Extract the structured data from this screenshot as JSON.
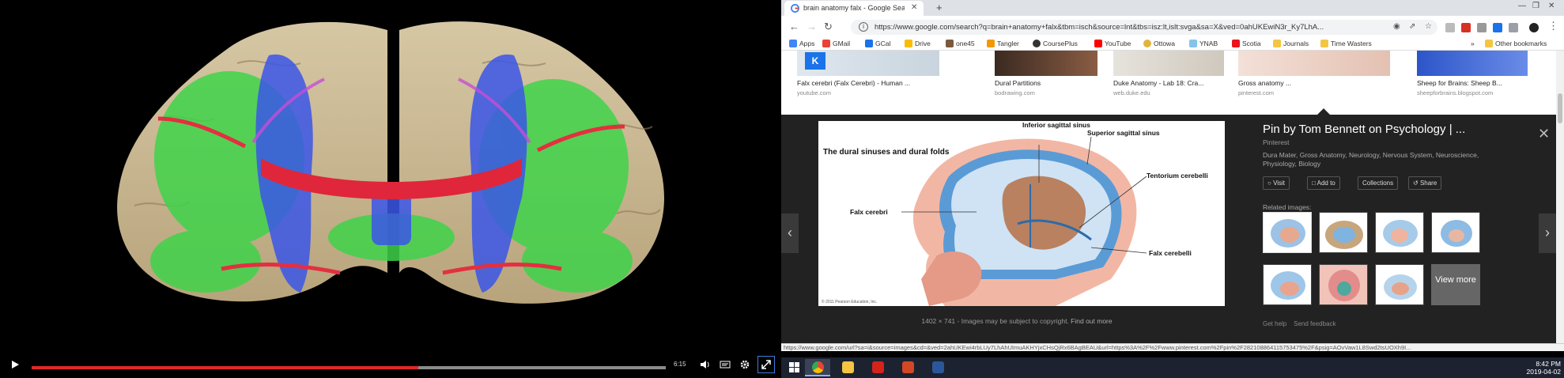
{
  "video": {
    "time": "6:15",
    "progress": 0.61,
    "buffered": 1.0
  },
  "browser": {
    "tab_title": "brain anatomy falx - Google Sea",
    "new_tab": "+",
    "tab_close": "✕",
    "url": "https://www.google.com/search?q=brain+anatomy+falx&tbm=isch&source=lnt&tbs=isz:lt,islt:svga&sa=X&ved=0ahUKEwiN3r_Ky7LhA...",
    "bookmarks": [
      "Apps",
      "GMail",
      "GCal",
      "Drive",
      "one45",
      "Tangler",
      "CoursePlus",
      "YouTube",
      "Ottowa",
      "YNAB",
      "Scotia",
      "Journals",
      "Time Wasters"
    ],
    "other_bookmarks": "Other bookmarks",
    "more": "»"
  },
  "results": [
    {
      "title": "Falx cerebri (Falx Cerebri) - Human ...",
      "source": "youtube.com"
    },
    {
      "title": "Dural Partitions",
      "source": "bodrawing.com"
    },
    {
      "title": "Duke Anatomy - Lab 18: Cra...",
      "source": "web.duke.edu"
    },
    {
      "title": "Gross anatomy ...",
      "source": "pinterest.com"
    },
    {
      "title": "Sheep for Brains: Sheep B...",
      "source": "sheepforbrains.blogspot.com"
    }
  ],
  "result_badge": "K",
  "diagram": {
    "heading": "The dural sinuses and dural folds",
    "labels": [
      "Inferior sagittal sinus",
      "Superior sagittal sinus",
      "Tentorium cerebelli",
      "Falx cerebri",
      "Falx cerebelli"
    ],
    "copyright": "© 2011 Pearson Education, Inc."
  },
  "panel": {
    "dims": "1402 × 741",
    "notice": "- Images may be subject to copyright.",
    "find_out_more": "Find out more",
    "title": "Pin by Tom Bennett on Psychology | ...",
    "source": "Pinterest",
    "tags": "Dura Mater, Gross Anatomy, Neurology, Nervous System, Neuroscience, Physiology, Biology",
    "buttons": [
      "Visit",
      "Add to",
      "Collections",
      "Share"
    ],
    "related_label": "Related images:",
    "view_more": "View more",
    "help": "Get help",
    "feedback": "Send feedback",
    "prev": "‹",
    "next": "›",
    "close": "✕"
  },
  "status_url": "https://www.google.com/url?sa=i&source=images&cd=&ved=2ahUKEwi4rbLUy7LhAhUImuAKHYjxCHsQjRx6BAgBEAU&url=https%3A%2F%2Fwww.pinterest.com%2Fpin%2F282108864115753475%2F&psig=AOvVaw1L8Swd2tsUOXh9I...",
  "taskbar": {
    "time": "8:42 PM",
    "date": "2019-04-02"
  }
}
